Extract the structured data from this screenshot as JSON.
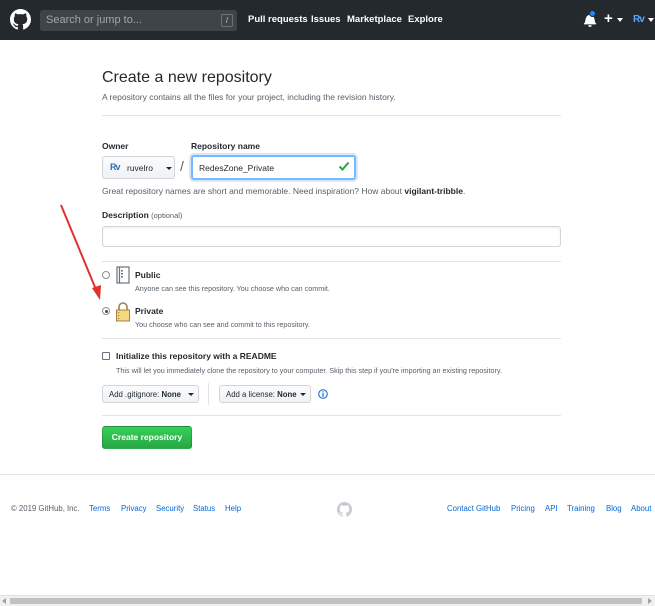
{
  "header": {
    "search_placeholder": "Search or jump to...",
    "search_shortcut": "/",
    "nav": [
      "Pull requests",
      "Issues",
      "Marketplace",
      "Explore"
    ],
    "plus_label": "+",
    "avatar_initials": "Rv"
  },
  "main": {
    "title": "Create a new repository",
    "subtitle": "A repository contains all the files for your project, including the revision history.",
    "owner_label": "Owner",
    "owner_avatar": "Rv",
    "owner_value": "ruvelro",
    "separator": "/",
    "repo_label": "Repository name",
    "repo_value": "RedesZone_Private",
    "hint_text": "Great repository names are short and memorable. Need inspiration? How about ",
    "hint_suggestion": "vigilant-tribble",
    "hint_end": ".",
    "description_label": "Description",
    "description_optional": "(optional)",
    "description_value": "",
    "visibility": {
      "public_title": "Public",
      "public_note": "Anyone can see this repository. You choose who can commit.",
      "private_title": "Private",
      "private_note": "You choose who can see and commit to this repository.",
      "selected": "Private"
    },
    "readme_title": "Initialize this repository with a README",
    "readme_note": "This will let you immediately clone the repository to your computer. Skip this step if you're importing an existing repository.",
    "readme_checked": false,
    "gitignore_label": "Add .gitignore:",
    "gitignore_value": "None",
    "license_label": "Add a license:",
    "license_value": "None",
    "create_button": "Create repository"
  },
  "footer": {
    "copyright": "© 2019 GitHub, Inc.",
    "left_links": [
      "Terms",
      "Privacy",
      "Security",
      "Status",
      "Help"
    ],
    "right_links": [
      "Contact GitHub",
      "Pricing",
      "API",
      "Training",
      "Blog",
      "About"
    ]
  },
  "colors": {
    "header_bg": "#24292e",
    "accent_green": "#28a745",
    "link_blue": "#0366d6",
    "annotation_red": "#e03131"
  }
}
